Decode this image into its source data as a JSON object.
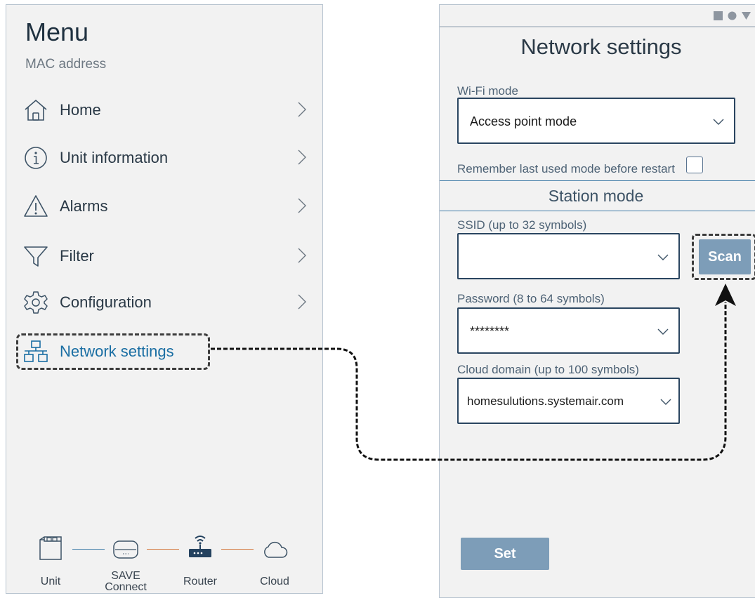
{
  "menu": {
    "title": "Menu",
    "mac_label": "MAC address",
    "items": [
      {
        "label": "Home",
        "icon": "home-icon"
      },
      {
        "label": "Unit information",
        "icon": "info-icon"
      },
      {
        "label": "Alarms",
        "icon": "alarm-icon"
      },
      {
        "label": "Filter",
        "icon": "filter-icon"
      },
      {
        "label": "Configuration",
        "icon": "gear-icon"
      },
      {
        "label": "Network settings",
        "icon": "network-icon",
        "active": true
      }
    ],
    "connection": {
      "unit": "Unit",
      "save_connect_line1": "SAVE",
      "save_connect_line2": "Connect",
      "router": "Router",
      "cloud": "Cloud"
    }
  },
  "network": {
    "title": "Network settings",
    "wifi_mode_label": "Wi-Fi mode",
    "wifi_mode_value": "Access point mode",
    "remember_label": "Remember last used mode before restart",
    "remember_checked": false,
    "section_title": "Station mode",
    "ssid_label": "SSID (up to 32 symbols)",
    "ssid_value": "",
    "scan_label": "Scan",
    "password_label": "Password (8 to 64 symbols)",
    "password_value": "********",
    "cloud_label": "Cloud domain (up to 100 symbols)",
    "cloud_value": "homesulutions.systemair.com",
    "set_label": "Set"
  },
  "colors": {
    "accent_blue": "#1a6ea3",
    "button_fill": "#7d9db8",
    "line_blue": "#3f7ca8",
    "line_orange": "#d2753a",
    "panel_bg": "#f2f2f2"
  }
}
